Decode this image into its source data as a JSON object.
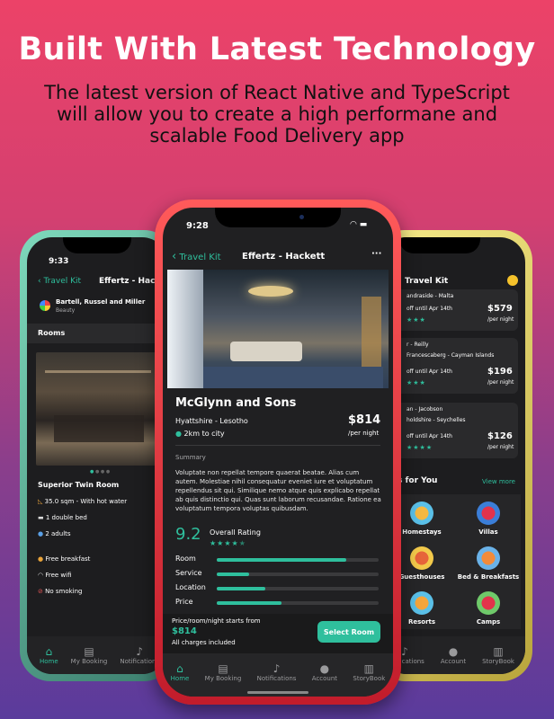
{
  "hero": {
    "title": "Built With Latest Technology",
    "subtitle_line1": "The latest version of React Native and TypeScript",
    "subtitle_line2": "will allow you to create a high performane and",
    "subtitle_line3": "scalable Food Delivery app"
  },
  "left_phone": {
    "time": "9:33",
    "back_label": "Travel Kit",
    "title": "Effertz - Hackett",
    "vendor_name": "Bartell, Russel and Miller",
    "vendor_category": "Beauty",
    "section_rooms": "Rooms",
    "room_name": "Superior Twin Room",
    "features": [
      "35.0 sqm - With hot water",
      "1 double bed",
      "2 adults"
    ],
    "amenities": [
      "Free breakfast",
      "Free wifi",
      "No smoking"
    ],
    "tabs": [
      "Home",
      "My Booking",
      "Notifications"
    ]
  },
  "center_phone": {
    "time": "9:28",
    "back_label": "Travel Kit",
    "title": "Effertz - Hackett",
    "more": "···",
    "hotel_name": "McGlynn and Sons",
    "location": "Hyattshire - Lesotho",
    "distance": "2km to city",
    "price": "$814",
    "per_night": "/per night",
    "summary_label": "Summary",
    "summary_text": "Voluptate non repellat tempore quaerat beatae. Alias cum autem. Molestiae nihil consequatur eveniet iure et voluptatum repellendus sit qui. Similique nemo atque quis explicabo repellat ab quis distinctio qui. Quas sunt laborum recusandae. Ratione ea voluptatum tempora voluptas quibusdam.",
    "rating_value": "9.2",
    "rating_label": "Overall Rating",
    "rating_stars": 4.5,
    "ratings": [
      {
        "label": "Room",
        "value": 0.8
      },
      {
        "label": "Service",
        "value": 0.2
      },
      {
        "label": "Location",
        "value": 0.3
      },
      {
        "label": "Price",
        "value": 0.4
      }
    ],
    "footer_note": "Price/room/night starts from",
    "footer_price": "$814",
    "footer_charges": "All charges included",
    "select_button": "Select Room",
    "tabs": [
      "Home",
      "My Booking",
      "Notifications",
      "Account",
      "StoryBook"
    ]
  },
  "right_phone": {
    "back_label": "Travel Kit",
    "listings": [
      {
        "line1": "andraside - Malta",
        "offer": "off until Apr 14th",
        "price": "$579",
        "per": "/per night"
      },
      {
        "line1": "r - Reilly",
        "line2": "Francescaberg - Cayman Islands",
        "offer": "off until Apr 14th",
        "price": "$196",
        "per": "/per night"
      },
      {
        "line1": "an - Jacobson",
        "line2": "holdshire - Seychelles",
        "offer": "off until Apr 14th",
        "price": "$126",
        "per": "/per night"
      }
    ],
    "section_title": "s for You",
    "view_more": "View more",
    "categories": [
      "Homestays",
      "Villas",
      "Guesthouses",
      "Bed & Breakfasts",
      "Resorts",
      "Camps"
    ],
    "tabs": [
      "Notifications",
      "Account",
      "StoryBook"
    ]
  },
  "colors": {
    "accent": "#2fbf9d",
    "background_top": "#ec4268",
    "background_bottom": "#5a3b9c"
  }
}
